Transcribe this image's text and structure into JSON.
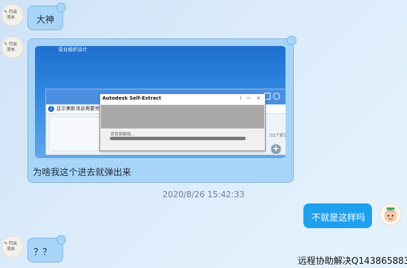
{
  "messages": [
    {
      "from": "contact",
      "text": "大神"
    },
    {
      "from": "contact",
      "type": "image",
      "caption": "为啥我这个进去就弹出来"
    },
    {
      "from": "me",
      "text": "不就是这样吗"
    },
    {
      "from": "contact",
      "text": "？？"
    }
  ],
  "timestamp": "2020/8/26 15:42:33",
  "screenshot": {
    "desktop_label": "营业组织设计",
    "info_bar_text": "显示美新消息需要完",
    "right_note": "017安装",
    "dialog": {
      "title": "Autodesk Self-Extract",
      "controls": [
        "i",
        "—",
        "×"
      ],
      "status_text": "正在初始化...",
      "progress_fraction": 0.92
    }
  },
  "footer": "远程协助解决Q1438658837",
  "colors": {
    "contact_bubble": "#a8d4f7",
    "my_bubble": "#1ea0ee",
    "background": "#dcecfb"
  }
}
